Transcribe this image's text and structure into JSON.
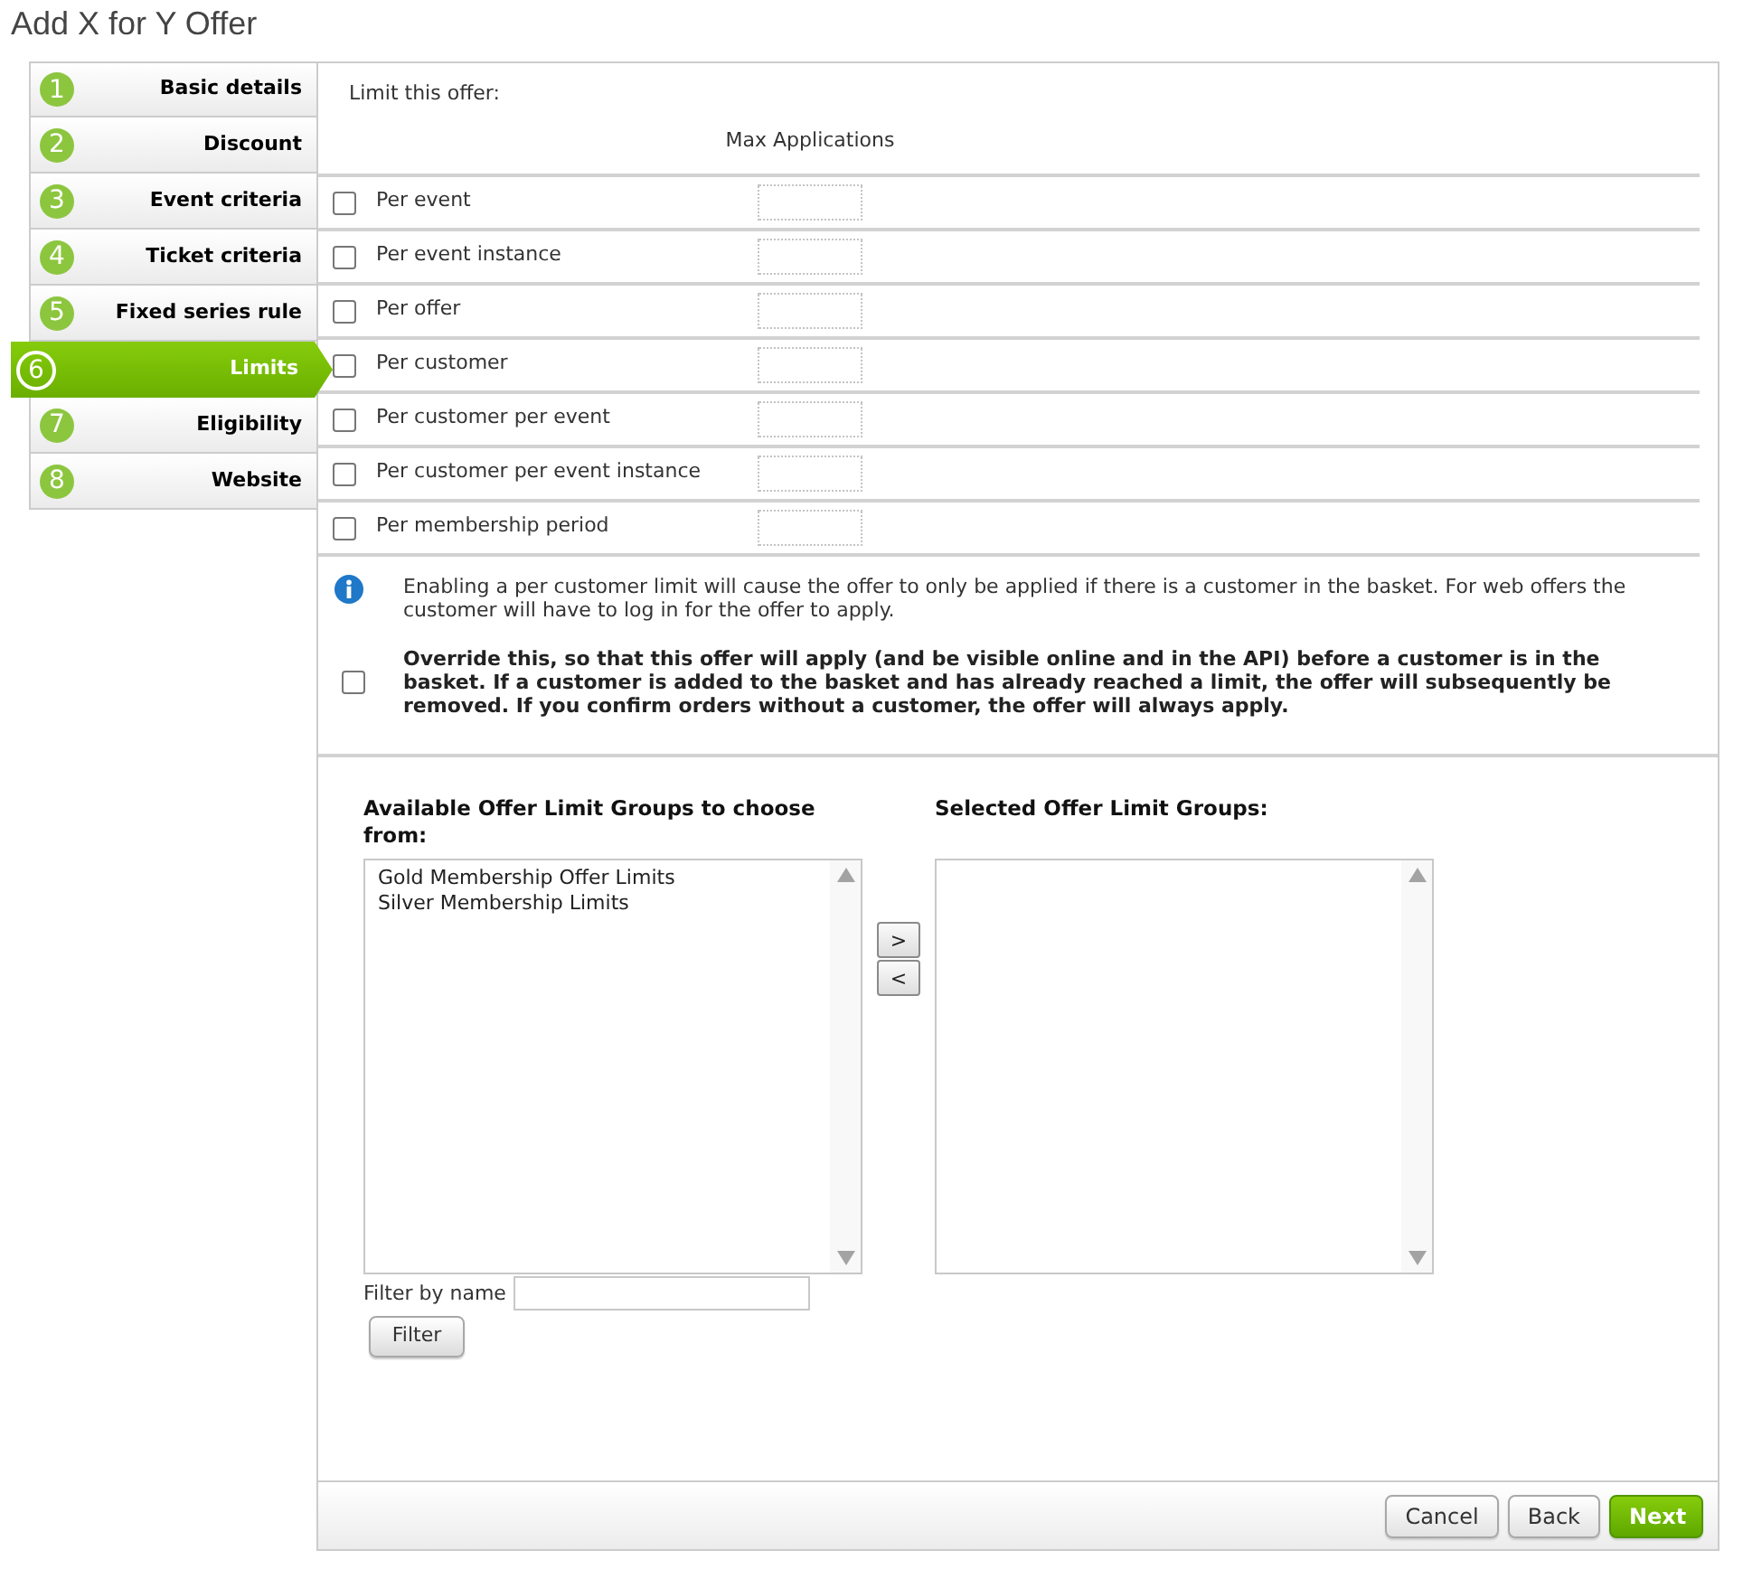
{
  "page": {
    "title": "Add X for Y Offer"
  },
  "steps": [
    {
      "number": "1",
      "label": "Basic details",
      "selected": false
    },
    {
      "number": "2",
      "label": "Discount",
      "selected": false
    },
    {
      "number": "3",
      "label": "Event criteria",
      "selected": false
    },
    {
      "number": "4",
      "label": "Ticket criteria",
      "selected": false
    },
    {
      "number": "5",
      "label": "Fixed series rule",
      "selected": false
    },
    {
      "number": "6",
      "label": "Limits",
      "selected": true
    },
    {
      "number": "7",
      "label": "Eligibility",
      "selected": false
    },
    {
      "number": "8",
      "label": "Website",
      "selected": false
    }
  ],
  "limits": {
    "heading": "Limit this offer:",
    "column_header": "Max Applications",
    "rows": [
      {
        "label": "Per event",
        "checked": false
      },
      {
        "label": "Per event instance",
        "checked": false
      },
      {
        "label": "Per offer",
        "checked": false
      },
      {
        "label": "Per customer",
        "checked": false
      },
      {
        "label": "Per customer per event",
        "checked": false
      },
      {
        "label": "Per customer per event instance",
        "checked": false
      },
      {
        "label": "Per membership period",
        "checked": false
      }
    ]
  },
  "notice": {
    "text": "Enabling a per customer limit will cause the offer to only be applied if there is a customer in the basket. For web offers the customer will have to log in for the offer to apply.",
    "override": {
      "text": "Override this, so that this offer will apply (and be visible online and in the API) before a customer is in the basket. If a customer is added to the basket and has already reached a limit, the offer will subsequently be removed. If you confirm orders without a customer, the offer will always apply.",
      "checked": false
    }
  },
  "offer_limit_groups": {
    "available": {
      "heading": "Available Offer Limit Groups to choose from:",
      "items": [
        {
          "label": "Gold Membership Offer Limits",
          "selected": false
        },
        {
          "label": "Silver Membership Limits",
          "selected": false
        }
      ]
    },
    "move_buttons": [
      ">",
      "<"
    ],
    "selected_list": {
      "heading": "Selected Offer Limit Groups:"
    },
    "filter": {
      "label": "Filter by name",
      "button": "Filter"
    }
  },
  "footer": {
    "buttons": [
      {
        "label": "Cancel",
        "kind": "secondary"
      },
      {
        "label": "Back",
        "kind": "secondary"
      },
      {
        "label": "Next",
        "kind": "primary"
      }
    ]
  }
}
